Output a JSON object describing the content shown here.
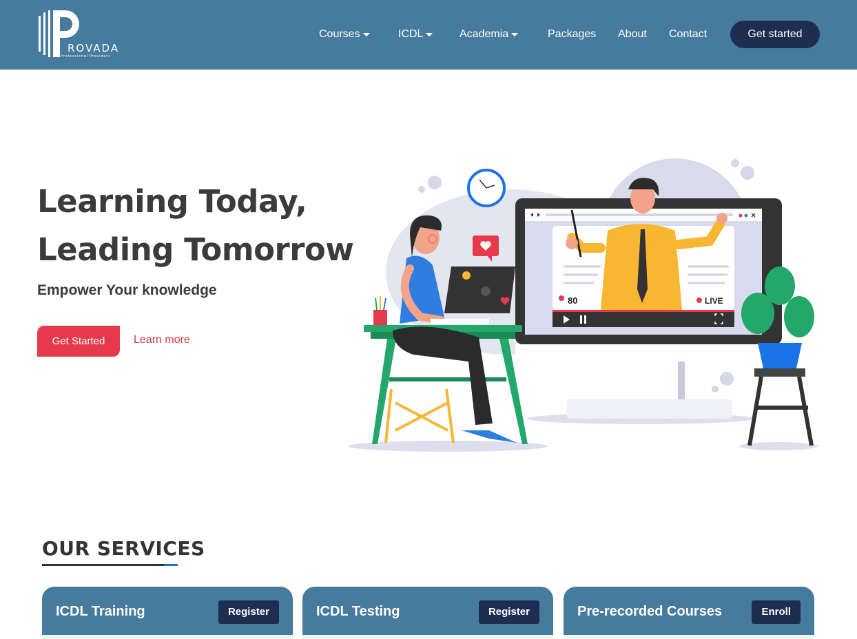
{
  "brand": {
    "name": "ROVADA",
    "tagline": "Professional Providers"
  },
  "nav": {
    "items": [
      {
        "label": "Courses",
        "dropdown": true
      },
      {
        "label": "ICDL",
        "dropdown": true
      },
      {
        "label": "Academia",
        "dropdown": true
      },
      {
        "label": "Packages",
        "dropdown": false
      },
      {
        "label": "About",
        "dropdown": false
      },
      {
        "label": "Contact",
        "dropdown": false
      }
    ],
    "cta_label": "Get started"
  },
  "hero": {
    "title_line1": "Learning Today,",
    "title_line2": "Leading Tomorrow",
    "subtitle": "Empower Your knowledge",
    "primary_button": "Get Started",
    "secondary_link": "Learn more"
  },
  "illustration": {
    "viewer_count": "80",
    "live_label": "LIVE"
  },
  "services": {
    "heading": "OUR SERVICES",
    "cards": [
      {
        "title": "ICDL Training",
        "button": "Register"
      },
      {
        "title": "ICDL Testing",
        "button": "Register"
      },
      {
        "title": "Pre-recorded Courses",
        "button": "Enroll"
      }
    ]
  },
  "colors": {
    "header_bg": "#467b9d",
    "navy": "#1e2e50",
    "accent_red": "#e63a4c",
    "text_dark": "#3b3b3b"
  }
}
